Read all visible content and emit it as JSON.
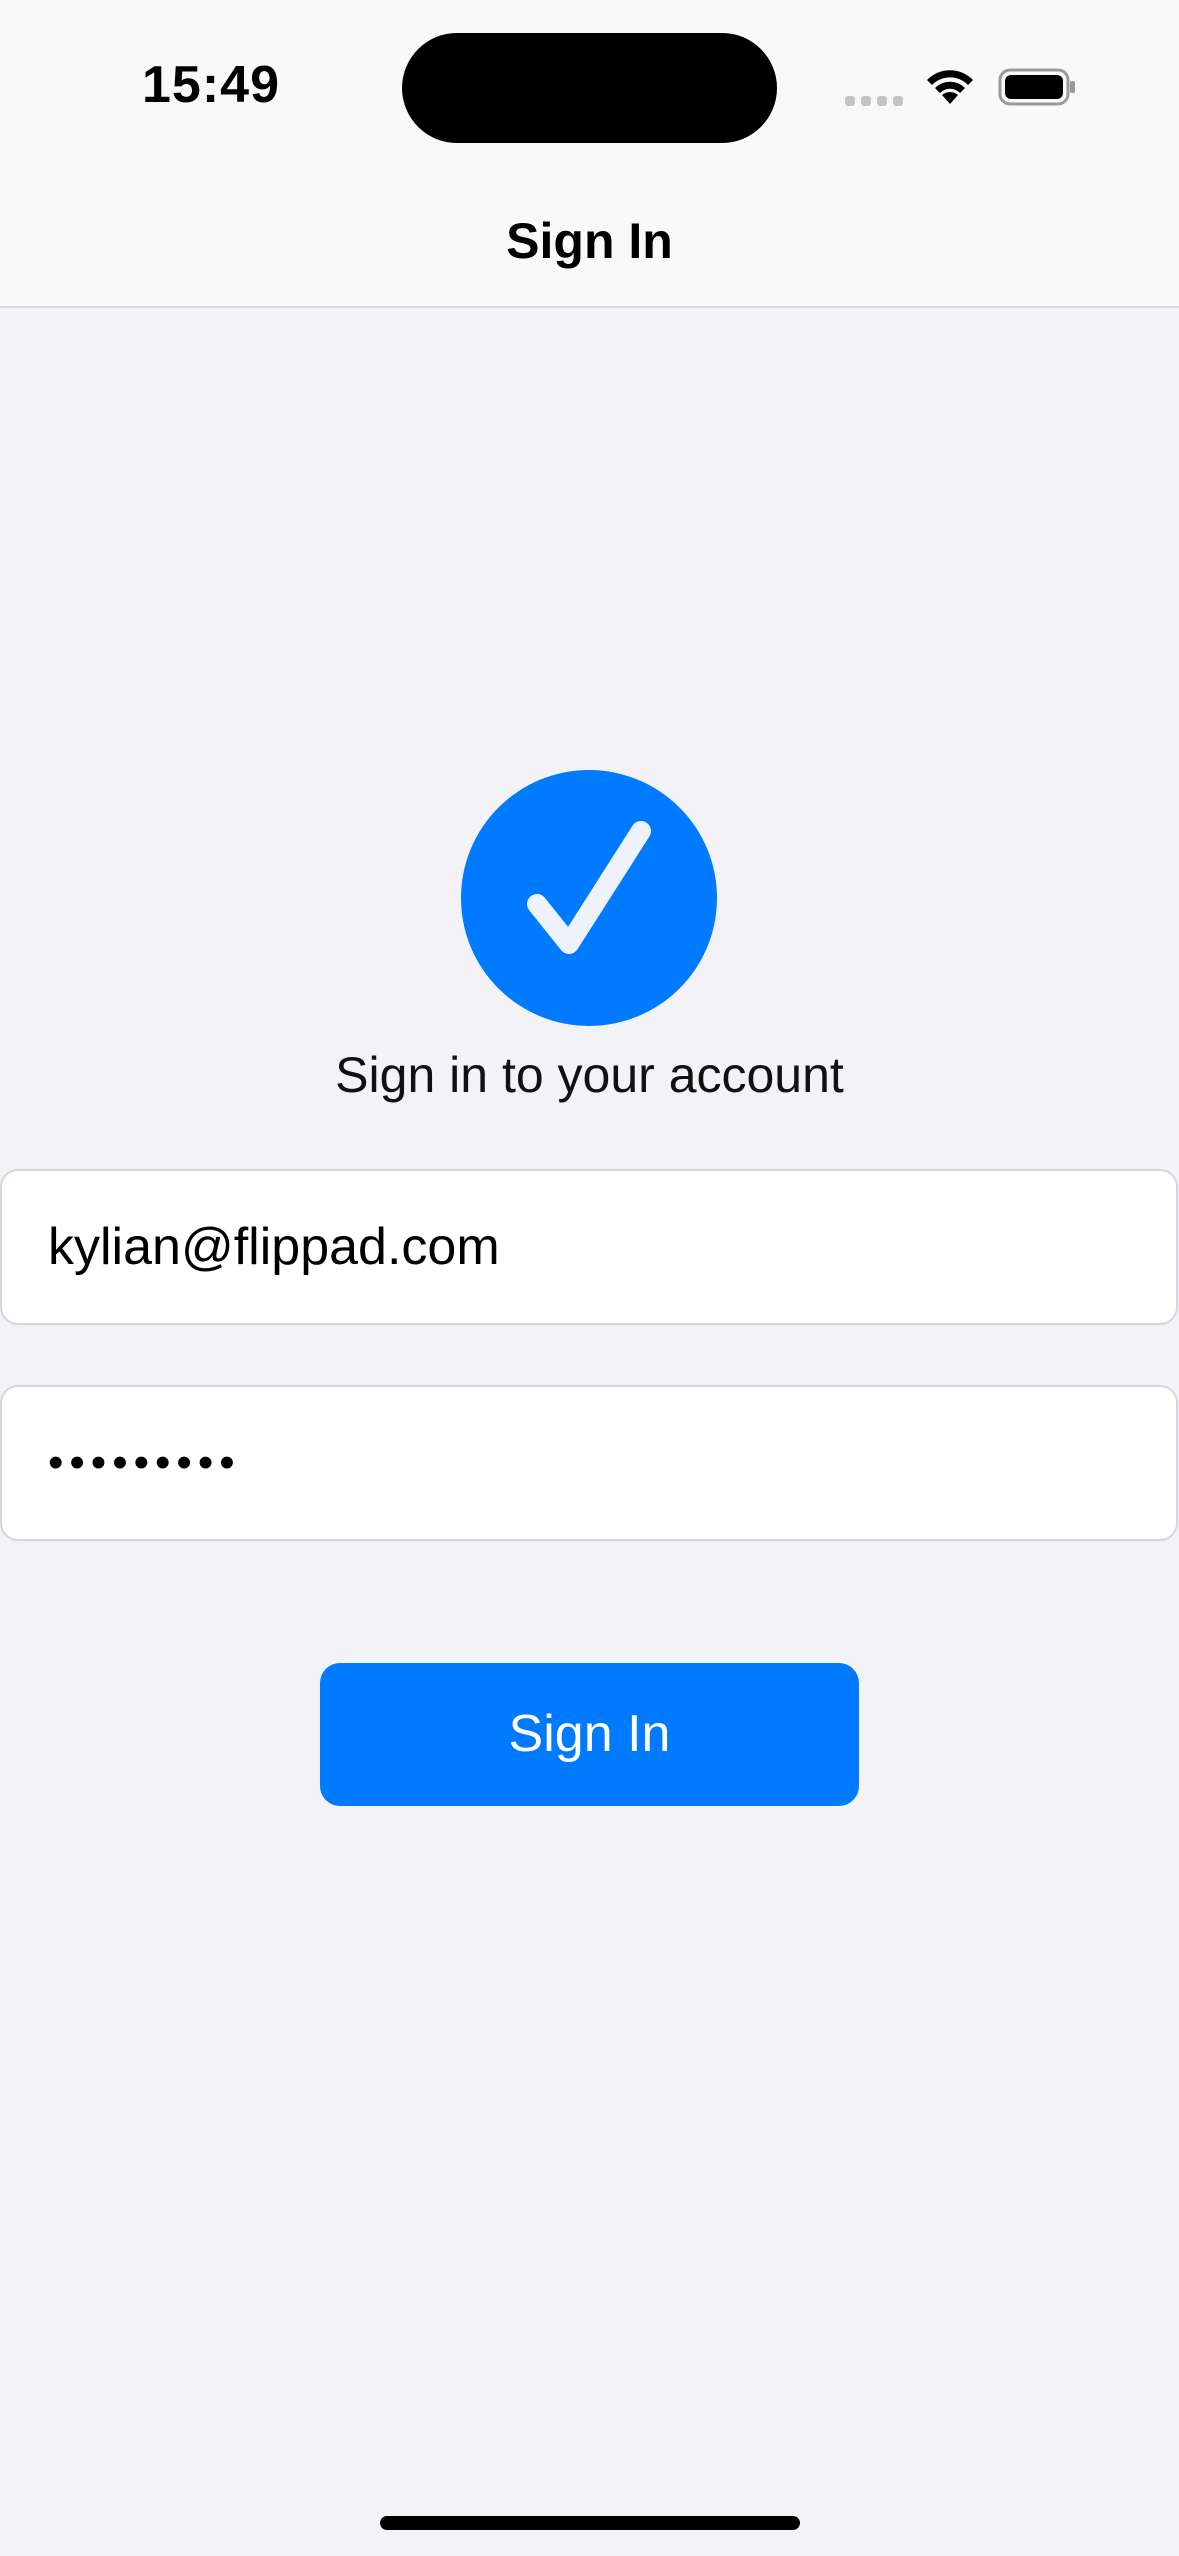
{
  "status_bar": {
    "time": "15:49"
  },
  "nav": {
    "title": "Sign In"
  },
  "hero": {
    "icon": "checkmark-circle-icon",
    "subtitle": "Sign in to your account"
  },
  "form": {
    "email_value": "kylian@flippad.com",
    "password_value": "•••••••••"
  },
  "actions": {
    "sign_in_label": "Sign In"
  },
  "colors": {
    "accent": "#007aff",
    "background": "#f2f2f7"
  }
}
